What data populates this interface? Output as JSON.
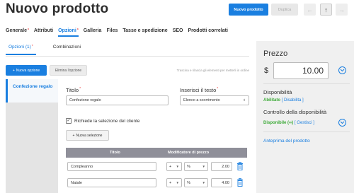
{
  "header": {
    "title": "Nuovo prodotto",
    "new_product_label": "Nuovo prodotto",
    "duplicate_label": "Duplica",
    "nav_prev": "←",
    "nav_up": "↑",
    "nav_next": "→"
  },
  "main_tabs": [
    {
      "label": "Generale",
      "required": "*"
    },
    {
      "label": "Attributi",
      "required": ""
    },
    {
      "label": "Opzioni",
      "required": "*"
    },
    {
      "label": "Galleria",
      "required": ""
    },
    {
      "label": "Files",
      "required": ""
    },
    {
      "label": "Tasse e spedizione",
      "required": ""
    },
    {
      "label": "SEO",
      "required": ""
    },
    {
      "label": "Prodotti correlati",
      "required": ""
    }
  ],
  "active_main_tab": "Opzioni",
  "sub_tabs": {
    "options": "Opzioni (1)",
    "options_required": "*",
    "combinations": "Combinazioni"
  },
  "toolbar": {
    "add_option": "Nuova opzione",
    "delete_option": "Elimina l'opzione",
    "drag_hint": "Trascina e rilascia gli elementi per metterli in ordine"
  },
  "option_list": [
    {
      "label": "Confezione regalo"
    }
  ],
  "form": {
    "title_label": "Titolo",
    "title_required": "*",
    "title_value": "Confezione regalo",
    "insert_text_label": "Inserisci il testo",
    "insert_text_required": "*",
    "insert_text_value": "Elenco a scorrimento",
    "require_selection_label": "Richiede la selezione del cliente",
    "require_selection_checked": true,
    "new_selection_label": "Nuova selezione"
  },
  "selections_table": {
    "headers": [
      "Titolo",
      "Modificatore di prezzo"
    ],
    "rows": [
      {
        "title": "Compleanno",
        "sign": "+",
        "type": "%",
        "value": "2.00"
      },
      {
        "title": "Natale",
        "sign": "+",
        "type": "%",
        "value": "4.00"
      }
    ]
  },
  "price_panel": {
    "label": "Prezzo",
    "currency": "$",
    "value": "10.00",
    "availability_label": "Disponibilità",
    "availability_status": "Abilitato",
    "availability_action": "[ Disabilita ]",
    "stock_control_label": "Controllo della disponibilità",
    "stock_status": "Disponibile",
    "stock_symbol": "(∞)",
    "stock_action": "[ Gestisci ]",
    "preview_link": "Anteprima del prodotto"
  },
  "colors": {
    "accent": "#1a7fe0",
    "success": "#3aa935",
    "required": "#e44444",
    "table_header": "#8f8f99"
  }
}
